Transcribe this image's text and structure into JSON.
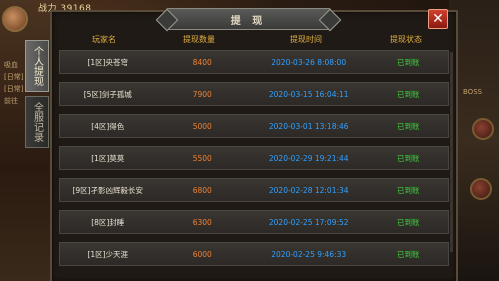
{
  "hud": {
    "power_text": "战力 39168",
    "left_labels": [
      "吸血",
      "[日常]",
      "[日常]",
      "前往"
    ],
    "right_labels": [
      "BOSS"
    ]
  },
  "panel": {
    "title": "提 现",
    "close_label": "✕",
    "tabs": [
      {
        "label": "个人提现",
        "active": true
      },
      {
        "label": "全服记录",
        "active": false
      }
    ],
    "columns": [
      "玩家名",
      "提现数量",
      "提现时间",
      "提现状态"
    ],
    "rows": [
      {
        "name": "[1区]央苍穹",
        "amount": "8400",
        "time": "2020-03-26 8:08:00",
        "status": "已到账"
      },
      {
        "name": "[5区]剑子孤城",
        "amount": "7900",
        "time": "2020-03-15 16:04:11",
        "status": "已到账"
      },
      {
        "name": "[4区]得色",
        "amount": "5000",
        "time": "2020-03-01 13:18:46",
        "status": "已到账"
      },
      {
        "name": "[1区]莫莫",
        "amount": "5500",
        "time": "2020-02-29 19:21:44",
        "status": "已到账"
      },
      {
        "name": "[9区]孑影凶辉毅长安",
        "amount": "6800",
        "time": "2020-02-28 12:01:34",
        "status": "已到账"
      },
      {
        "name": "[8区]封睡",
        "amount": "6300",
        "time": "2020-02-25 17:09:52",
        "status": "已到账"
      },
      {
        "name": "[1区]少天涯",
        "amount": "6000",
        "time": "2020-02-25 9:46:33",
        "status": "已到账"
      }
    ]
  },
  "colors": {
    "amount": "#f08030",
    "time": "#30a0ff",
    "status": "#40d040",
    "header": "#e0b040"
  }
}
